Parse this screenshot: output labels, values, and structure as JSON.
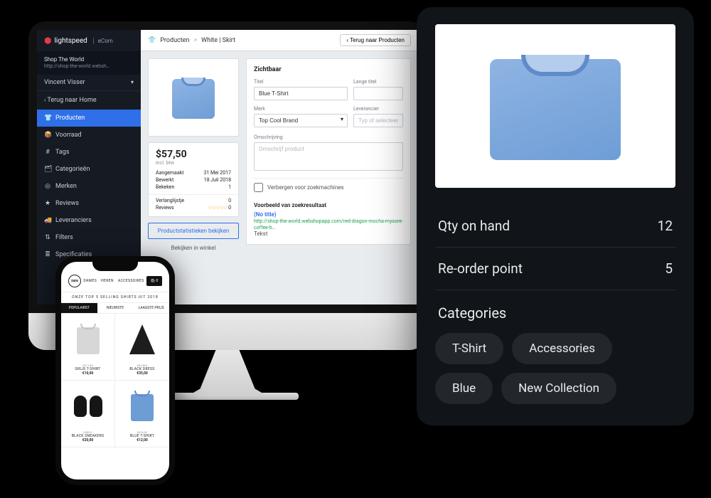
{
  "ecom": {
    "brand": "lightspeed",
    "brand_sub": "eCom",
    "shop_name": "Shop The World",
    "shop_url": "http://shop-the-world.websh…",
    "user": "Vincent Visser",
    "back_home": "Terug naar Home",
    "nav": [
      {
        "icon": "👕",
        "label": "Producten",
        "active": true
      },
      {
        "icon": "📦",
        "label": "Voorraad"
      },
      {
        "icon": "#",
        "label": "Tags"
      },
      {
        "icon": "🗂",
        "label": "Categorieën"
      },
      {
        "icon": "◎",
        "label": "Merken"
      },
      {
        "icon": "★",
        "label": "Reviews"
      },
      {
        "icon": "🚚",
        "label": "Leveranciers"
      },
      {
        "icon": "⇅",
        "label": "Filters"
      },
      {
        "icon": "≣",
        "label": "Specificaties"
      }
    ],
    "breadcrumb": {
      "root": "Producten",
      "sep": ">",
      "leaf": "White | Skirt",
      "back_btn": "Terug naar Producten"
    },
    "product": {
      "price": "$57,50",
      "incl": "incl. btw",
      "created_label": "Aangemaakt",
      "created_val": "31 Mei 2017",
      "updated_label": "Bewerkt",
      "updated_val": "18 Juli 2018",
      "views_label": "Bekeken",
      "views_val": "1",
      "wishlist_label": "Verlanglijstje",
      "wishlist_val": "0",
      "reviews_label": "Reviews",
      "reviews_stars": "☆☆☆☆☆",
      "reviews_val": "0",
      "stats_btn": "Productstatistieken bekijken",
      "view_store": "Bekijken in winkel"
    },
    "form": {
      "visible": "Zichtbaar",
      "title_label": "Titel",
      "title_val": "Blue T-Shirt",
      "long_title": "Lange titel",
      "brand_label": "Merk",
      "brand_val": "Top Cool Brand",
      "supplier_label": "Leverancier",
      "supplier_ph": "Typ of selecteer",
      "desc_label": "Omschrijving",
      "desc_ph": "Omschrijf product",
      "hide_search": "Verbergen voor zoekmachines",
      "preview_title": "Voorbeeld van zoekresultaat",
      "preview_no_title": "(No title)",
      "preview_url": "http://shop-the-world.webshopapp.com/red-dragon-mocha-mysore-coffee-b…",
      "preview_text": "Tekst"
    }
  },
  "mobile": {
    "logo": "zara",
    "nav": [
      "Dames",
      "Heren",
      "Accessoires"
    ],
    "cart": "🛍 0",
    "crumb": "ONZE TOP 5 SELLING SHIRTS UIT 2018",
    "sort": {
      "popular": "POPULAIRST",
      "newest": "NIEUWSTE",
      "low": "LAAGSTE PRIJS"
    },
    "products": [
      {
        "sku": "0311.03",
        "name": "Grijs T-shirt",
        "price": "€10,00"
      },
      {
        "sku": "03140.0",
        "name": "Black Dress",
        "price": "€35,00"
      },
      {
        "sku": "0332.0",
        "name": "Black Sneakers",
        "price": "€20,00"
      },
      {
        "sku": "0316.02",
        "name": "Blue T-Shirt",
        "price": "€12,00"
      }
    ]
  },
  "overlay": {
    "rows": [
      {
        "label": "Qty on hand",
        "value": "12"
      },
      {
        "label": "Re-order point",
        "value": "5"
      }
    ],
    "cat_title": "Categories",
    "chips": [
      "T-Shirt",
      "Accessories",
      "Blue",
      "New Collection"
    ]
  }
}
